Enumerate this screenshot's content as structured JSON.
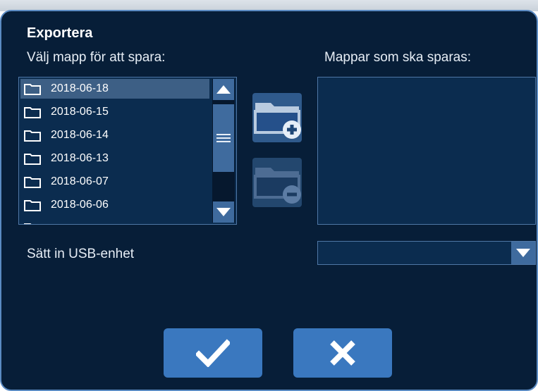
{
  "dialog": {
    "title": "Exportera",
    "choose_folder_label": "Välj mapp för att spara:",
    "folders_to_save_label": "Mappar som ska sparas:",
    "usb_label": "Sätt in USB-enhet",
    "usb_selected_value": ""
  },
  "folder_list": {
    "items": [
      {
        "label": "2018-06-18",
        "selected": true
      },
      {
        "label": "2018-06-15",
        "selected": false
      },
      {
        "label": "2018-06-14",
        "selected": false
      },
      {
        "label": "2018-06-13",
        "selected": false
      },
      {
        "label": "2018-06-07",
        "selected": false
      },
      {
        "label": "2018-06-06",
        "selected": false
      }
    ]
  },
  "selected_folders": [],
  "icons": {
    "add": "folder-add-icon",
    "remove": "folder-remove-icon",
    "ok": "checkmark-icon",
    "cancel": "close-icon",
    "scroll_up": "arrow-up-icon",
    "scroll_down": "arrow-down-icon"
  },
  "colors": {
    "background": "#071e38",
    "panel": "#0b2c4f",
    "accent": "#3a78bf",
    "selection": "#3d5f85",
    "border": "#5b8bc3"
  }
}
